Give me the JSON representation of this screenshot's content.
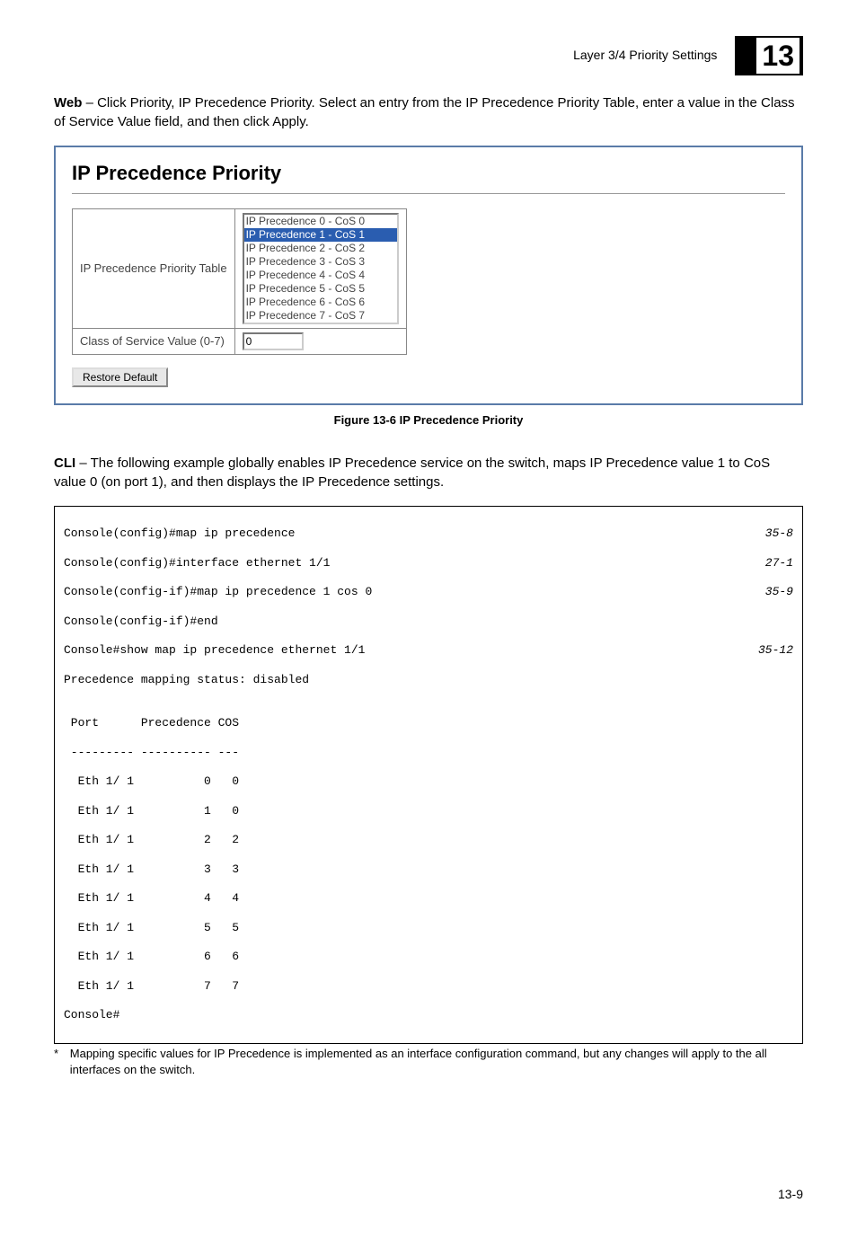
{
  "header": {
    "section": "Layer 3/4 Priority Settings",
    "chapter": "13"
  },
  "intro1_bold": "Web",
  "intro1_rest": " – Click Priority, IP Precedence Priority. Select an entry from the IP Precedence Priority Table, enter a value in the Class of Service Value field, and then click Apply.",
  "panel": {
    "title": "IP Precedence Priority",
    "row1_label": "IP Precedence Priority Table",
    "list": [
      "IP Precedence 0 - CoS 0",
      "IP Precedence 1 - CoS 1",
      "IP Precedence 2 - CoS 2",
      "IP Precedence 3 - CoS 3",
      "IP Precedence 4 - CoS 4",
      "IP Precedence 5 - CoS 5",
      "IP Precedence 6 - CoS 6",
      "IP Precedence 7 - CoS 7"
    ],
    "selected_index": 1,
    "row2_label": "Class of Service Value (0-7)",
    "row2_value": "0",
    "button": "Restore Default"
  },
  "figure_caption": "Figure 13-6   IP Precedence Priority",
  "intro2_bold": "CLI",
  "intro2_rest": " – The following example globally enables IP Precedence service on the switch, maps IP Precedence value 1 to CoS value 0 (on port 1), and then displays the IP Precedence settings.",
  "cli": {
    "l1": "Console(config)#map ip precedence",
    "r1": "35-8",
    "l2": "Console(config)#interface ethernet 1/1",
    "r2": "27-1",
    "l3": "Console(config-if)#map ip precedence 1 cos 0",
    "r3": "35-9",
    "l4": "Console(config-if)#end",
    "l5": "Console#show map ip precedence ethernet 1/1",
    "r5": "35-12",
    "l6": "Precedence mapping status: disabled",
    "blank": "",
    "h1": " Port      Precedence COS",
    "h2": " --------- ---------- ---",
    "d0": "  Eth 1/ 1          0   0",
    "d1": "  Eth 1/ 1          1   0",
    "d2": "  Eth 1/ 1          2   2",
    "d3": "  Eth 1/ 1          3   3",
    "d4": "  Eth 1/ 1          4   4",
    "d5": "  Eth 1/ 1          5   5",
    "d6": "  Eth 1/ 1          6   6",
    "d7": "  Eth 1/ 1          7   7",
    "end": "Console#"
  },
  "footnote_star": "*",
  "footnote_text": "Mapping specific values for IP Precedence is implemented as an interface configuration command, but any changes will apply to the all interfaces on the switch.",
  "page_number": "13-9"
}
